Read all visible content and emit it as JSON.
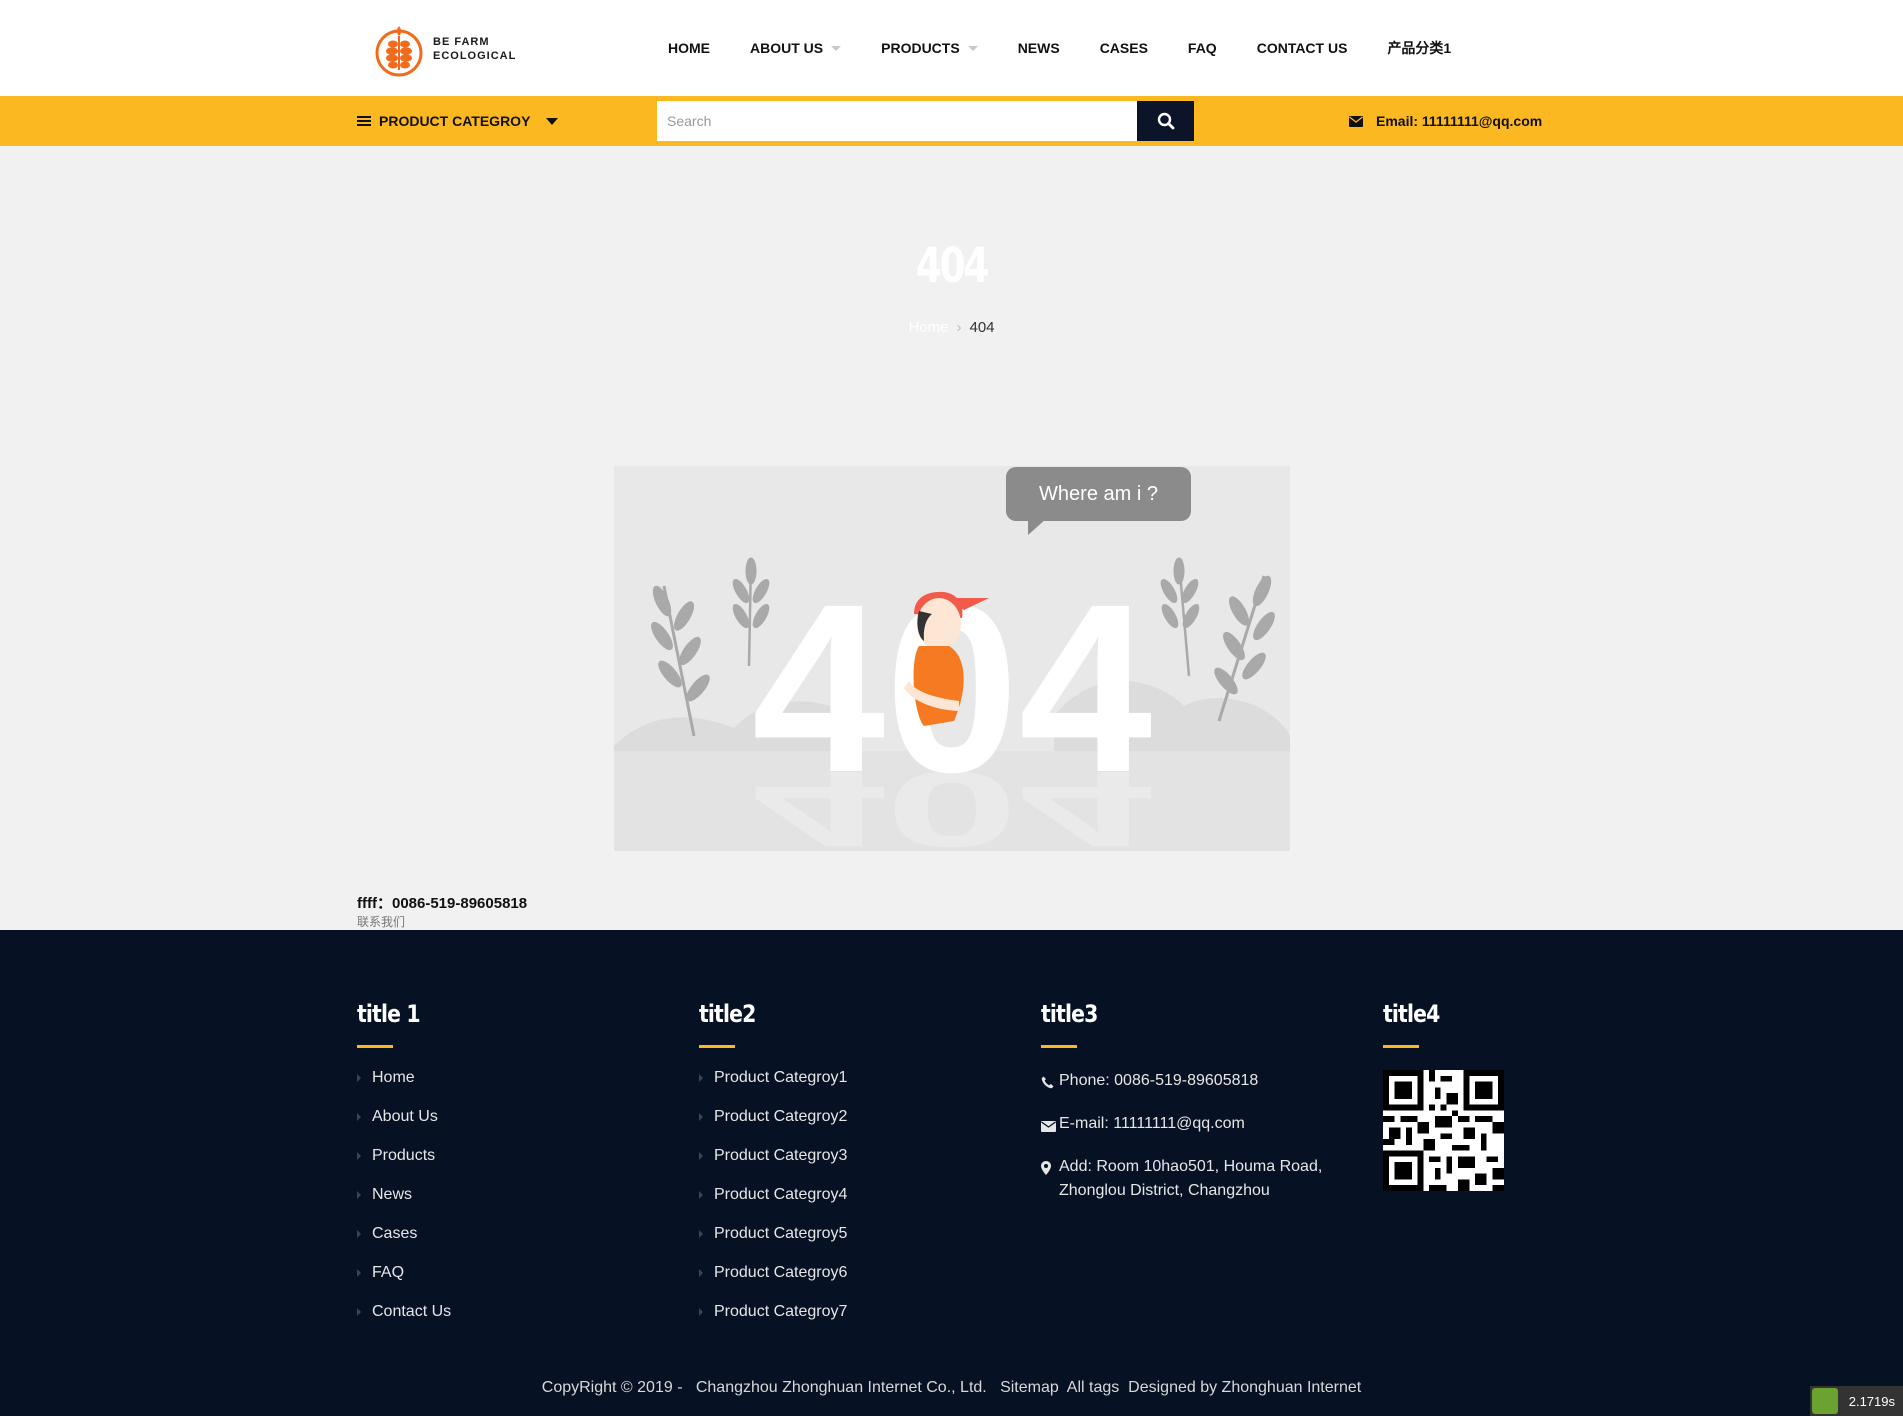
{
  "logo": {
    "line1": "BE FARM",
    "line2": "ECOLOGICAL",
    "brand_color": "#f26b1d"
  },
  "nav": {
    "items": [
      {
        "label": "HOME",
        "has_caret": false
      },
      {
        "label": "ABOUT US",
        "has_caret": true
      },
      {
        "label": "PRODUCTS",
        "has_caret": true
      },
      {
        "label": "NEWS",
        "has_caret": false
      },
      {
        "label": "CASES",
        "has_caret": false
      },
      {
        "label": "FAQ",
        "has_caret": false
      },
      {
        "label": "CONTACT US",
        "has_caret": false
      },
      {
        "label": "产品分类1",
        "has_caret": false
      }
    ]
  },
  "topbar": {
    "accent": "#fbb820",
    "category_label": "PRODUCT CATEGROY",
    "search_placeholder": "Search",
    "search_value": "",
    "search_icon": "search-icon",
    "email": "Email: 11111111@qq.com"
  },
  "banner": {
    "title": "404",
    "breadcrumb_home": "Home",
    "breadcrumb_current": "404"
  },
  "illustration": {
    "bubble_text": "Where am i ?",
    "big_text": "404"
  },
  "contact": {
    "line": "ffff：0086-519-89605818",
    "link": "联系我们"
  },
  "footer": {
    "bg": "#061124",
    "col1": {
      "title": "title 1",
      "items": [
        "Home",
        "About Us",
        "Products",
        "News",
        "Cases",
        "FAQ",
        "Contact Us"
      ]
    },
    "col2": {
      "title": "title2",
      "items": [
        "Product Categroy1",
        "Product Categroy2",
        "Product Categroy3",
        "Product Categroy4",
        "Product Categroy5",
        "Product Categroy6",
        "Product Categroy7"
      ]
    },
    "col3": {
      "title": "title3",
      "phone": "Phone: 0086-519-89605818",
      "email": "E-mail: 11111111@qq.com",
      "address": "Add: Room 10hao501, Houma Road, Zhonglou District, Changzhou"
    },
    "col4": {
      "title": "title4",
      "qr_icon": "qr-code-icon"
    },
    "copyright": "CopyRight © 2019 -   Changzhou Zhonghuan Internet Co., Ltd.",
    "sitemap": "Sitemap",
    "all_tags": "All tags",
    "designed_by": "Designed by Zhonghuan Internet"
  },
  "timer": "2.1719s"
}
